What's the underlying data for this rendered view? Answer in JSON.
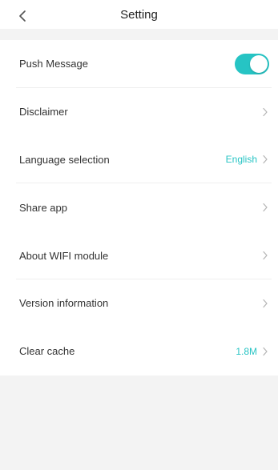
{
  "header": {
    "title": "Setting",
    "back_icon": "chevron-left-icon"
  },
  "settings": {
    "items": [
      {
        "label": "Push Message",
        "type": "toggle",
        "enabled": true
      },
      {
        "label": "Disclaimer",
        "type": "link",
        "icon": "chevron-right-icon"
      },
      {
        "label": "Language selection",
        "type": "link",
        "value": "English",
        "icon": "chevron-right-icon"
      },
      {
        "label": "Share app",
        "type": "link",
        "icon": "chevron-right-icon"
      },
      {
        "label": "About WIFI module",
        "type": "link",
        "icon": "chevron-right-icon"
      },
      {
        "label": "Version information",
        "type": "link",
        "icon": "chevron-right-icon"
      },
      {
        "label": "Clear cache",
        "type": "link",
        "value": "1.8M",
        "icon": "chevron-right-icon"
      }
    ]
  },
  "colors": {
    "accent": "#26c4c4",
    "background": "#f3f3f3",
    "surface": "#ffffff",
    "text": "#333333",
    "chevron": "#b3b3b3"
  }
}
